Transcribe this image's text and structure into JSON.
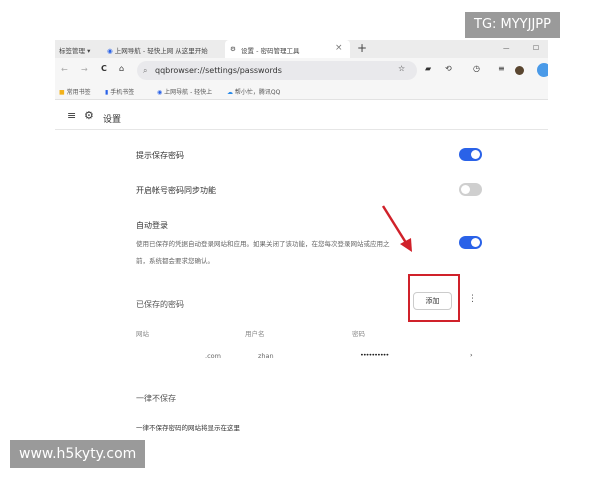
{
  "browser": {
    "tabs": [
      {
        "label": "标签管理 ▾"
      },
      {
        "label": "上网导航 - 轻快上网 从这里开始"
      },
      {
        "label": "设置 - 密码管理工具",
        "active": true
      }
    ],
    "new_tab": "+",
    "close": "×",
    "url": "qqbrowser://settings/passwords",
    "bookmarks": [
      {
        "label": "常用书签"
      },
      {
        "label": "手机书签"
      },
      {
        "label": "上网导航 - 轻快上"
      },
      {
        "label": "帮小忙，腾讯QQ"
      }
    ]
  },
  "header": {
    "title": "设置"
  },
  "settings": {
    "offer_save": {
      "label": "提示保存密码",
      "on": true
    },
    "sync": {
      "label": "开启帐号密码同步功能",
      "on": false
    },
    "auto_login": {
      "label": "自动登录",
      "desc1": "使用已保存的凭据自动登录网站和应用。如果关闭了该功能，在您每次登录网站或应用之",
      "desc2": "前，系统都会要求您确认。",
      "on": true
    }
  },
  "saved": {
    "title": "已保存的密码",
    "add_label": "添加",
    "columns": [
      "网站",
      "用户名",
      "密码"
    ],
    "rows": [
      {
        "site": ".com",
        "user": "zhan",
        "password": "••••••••••"
      }
    ]
  },
  "never": {
    "title": "一律不保存",
    "desc": "一律不保存密码的网站将显示在这里"
  },
  "annotation_color": "#d0212a",
  "watermarks": {
    "top": "TG: MYYJJPP",
    "bottom": "www.h5kyty.com"
  }
}
